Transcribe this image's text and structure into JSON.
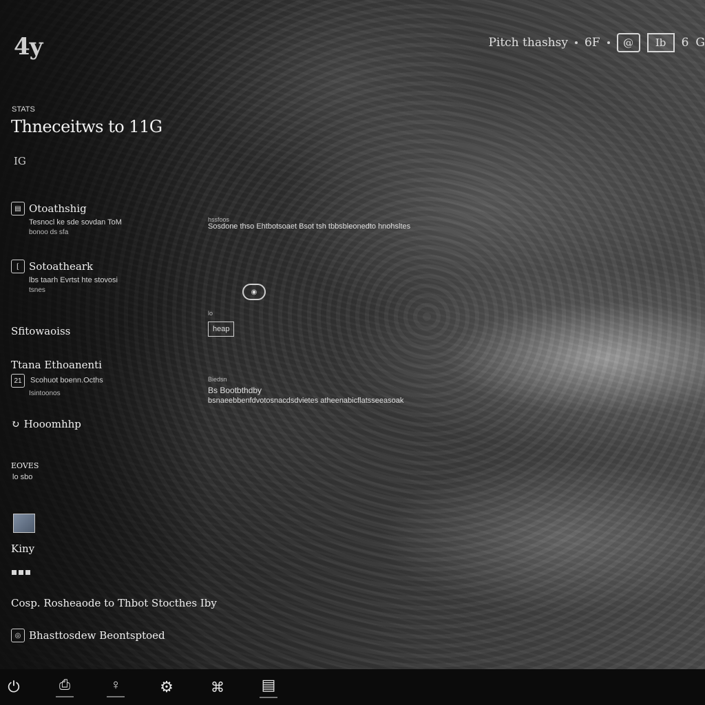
{
  "app": {
    "logo_text": "4y"
  },
  "topbar": {
    "user_label": "Pitch thashsy",
    "temp_label": "6F",
    "icon1": "@",
    "icon2": "Ib",
    "icon3": "6",
    "icon4": "G"
  },
  "header": {
    "kicker": "STATS",
    "title": "Thneceitws to 11G",
    "subtitle": "IG"
  },
  "sidebar": {
    "items": [
      {
        "title": "Otoathshig",
        "line1": "Tesnocl ke sde sovdan ToM",
        "line2": "bonoo ds sfa"
      },
      {
        "title": "Sotoatheark",
        "line1": "lbs taarh Evrtst hte stovosi",
        "line2": "tsnes"
      },
      {
        "title": "Sfitowaoiss",
        "line1": "",
        "line2": ""
      },
      {
        "title": "Ttana Ethoanenti",
        "line1": "Scohuot boenn.Ocths",
        "line2": "Isintoonos"
      },
      {
        "title": "Hooomhhp",
        "line1": "",
        "line2": ""
      },
      {
        "title": "EOVES",
        "line1": "lo sbo",
        "line2": ""
      },
      {
        "title": "Kiny",
        "line1": "",
        "line2": ""
      }
    ],
    "footer_line": "Cosp. Rosheaode to Thbot Stocthes Iby",
    "footer_link": "Bhasttosdew Beontsptoed"
  },
  "center": {
    "block1_label": "hssfoos",
    "block1_text": "Sosdone thso Ehtbotsoaet Bsot tsh tbbsbleonedto hnohsltes",
    "block2_label": "lo",
    "block2_box": "heap",
    "block3_label": "Biedsn",
    "block3_title": "Bs Bootbthdby",
    "block3_text": "bsnaeebbenfdvotosnacdsdvietes atheenabicflatsseeasoak"
  },
  "taskbar": {
    "icons": [
      "power-icon",
      "printer-icon",
      "bulb-icon",
      "settings-icon",
      "map-icon",
      "window-icon"
    ]
  },
  "colors": {
    "background": "#1c1c1c",
    "taskbar": "#0b0b0b",
    "text": "#e8e8e8"
  }
}
